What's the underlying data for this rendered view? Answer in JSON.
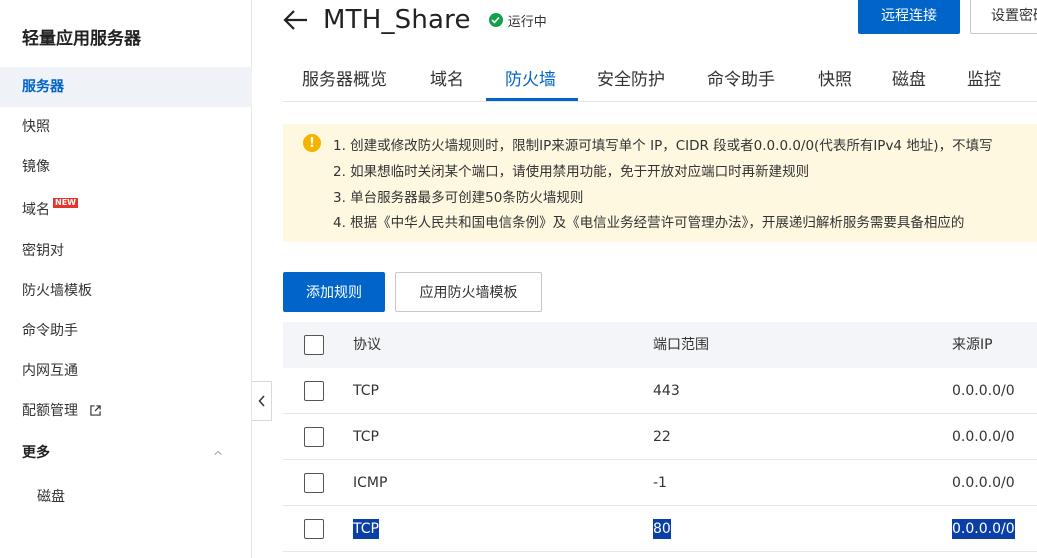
{
  "sidebar": {
    "title": "轻量应用服务器",
    "items": [
      {
        "label": "服务器",
        "active": true
      },
      {
        "label": "快照"
      },
      {
        "label": "镜像"
      },
      {
        "label": "域名",
        "badge": "NEW"
      },
      {
        "label": "密钥对"
      },
      {
        "label": "防火墙模板"
      },
      {
        "label": "命令助手"
      },
      {
        "label": "内网互通"
      },
      {
        "label": "配额管理"
      }
    ],
    "more_label": "更多",
    "sub_items": [
      {
        "label": "磁盘"
      }
    ]
  },
  "header": {
    "title": "MTH_Share",
    "status": "运行中",
    "remote_connect": "远程连接",
    "set_password": "设置密码"
  },
  "tabs": [
    {
      "label": "服务器概览"
    },
    {
      "label": "域名"
    },
    {
      "label": "防火墙",
      "active": true
    },
    {
      "label": "安全防护"
    },
    {
      "label": "命令助手"
    },
    {
      "label": "快照"
    },
    {
      "label": "磁盘"
    },
    {
      "label": "监控"
    }
  ],
  "notice": {
    "lines": [
      "1. 创建或修改防火墙规则时，限制IP来源可填写单个 IP，CIDR 段或者0.0.0.0/0(代表所有IPv4 地址)，不填写",
      "2. 如果想临时关闭某个端口，请使用禁用功能，免于开放对应端口时再新建规则",
      "3. 单台服务器最多可创建50条防火墙规则",
      "4. 根据《中华人民共和国电信条例》及《电信业务经营许可管理办法》，开展递归解析服务需要具备相应的"
    ]
  },
  "actions": {
    "add_rule": "添加规则",
    "apply_template": "应用防火墙模板"
  },
  "table": {
    "headers": {
      "protocol": "协议",
      "port_range": "端口范围",
      "source_ip": "来源IP"
    },
    "rows": [
      {
        "protocol": "TCP",
        "port": "443",
        "source": "0.0.0.0/0"
      },
      {
        "protocol": "TCP",
        "port": "22",
        "source": "0.0.0.0/0"
      },
      {
        "protocol": "ICMP",
        "port": "-1",
        "source": "0.0.0.0/0"
      },
      {
        "protocol": "TCP",
        "port": "80",
        "source": "0.0.0.0/0",
        "text_selected": true
      }
    ]
  },
  "colors": {
    "primary": "#0064c8",
    "status_green": "#13a04b",
    "notice_bg": "#fff8e1",
    "warn_icon": "#f5b301",
    "badge_red": "#e6362c",
    "selection": "#0a3fa8"
  }
}
